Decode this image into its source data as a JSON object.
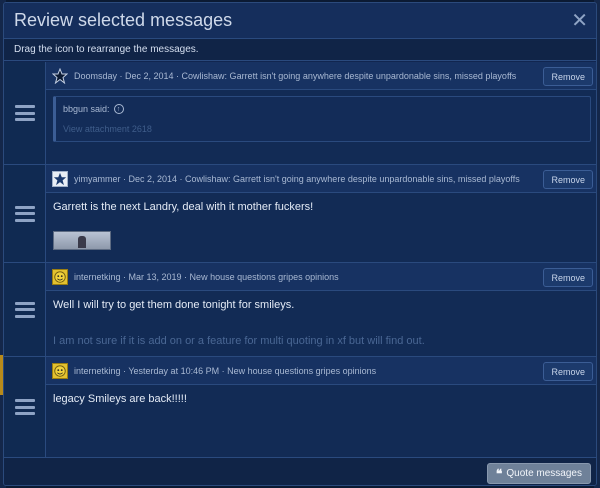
{
  "modal": {
    "title": "Review selected messages",
    "hint": "Drag the icon to rearrange the messages.",
    "close_glyph": "✕",
    "remove_label": "Remove",
    "quote_button_label": "Quote messages",
    "quote_button_icon": "❝"
  },
  "messages": [
    {
      "avatar": "star-icon",
      "meta": "Doomsday · Dec 2, 2014 · Cowlishaw: Garrett isn't going anywhere despite unpardonable sins, missed playoffs",
      "quote_author": "bbgun said:",
      "quote_attachment": "View attachment 2618"
    },
    {
      "avatar": "star-icon",
      "meta": "yimyammer · Dec 2, 2014 · Cowlishaw: Garrett isn't going anywhere despite unpardonable sins, missed playoffs",
      "text": "Garrett is the next Landry, deal with it mother fuckers!"
    },
    {
      "avatar": "smiley-icon",
      "meta": "internetking · Mar 13, 2019 · New house questions gripes opinions",
      "text": "Well I will try to get them done tonight for smileys.",
      "text2": "I am not sure if it is add on or a feature for multi quoting in xf but will find out."
    },
    {
      "avatar": "smiley-icon",
      "meta": "internetking · Yesterday at 10:46 PM · New house questions gripes opinions",
      "text": "legacy Smileys are back!!!!!"
    }
  ]
}
